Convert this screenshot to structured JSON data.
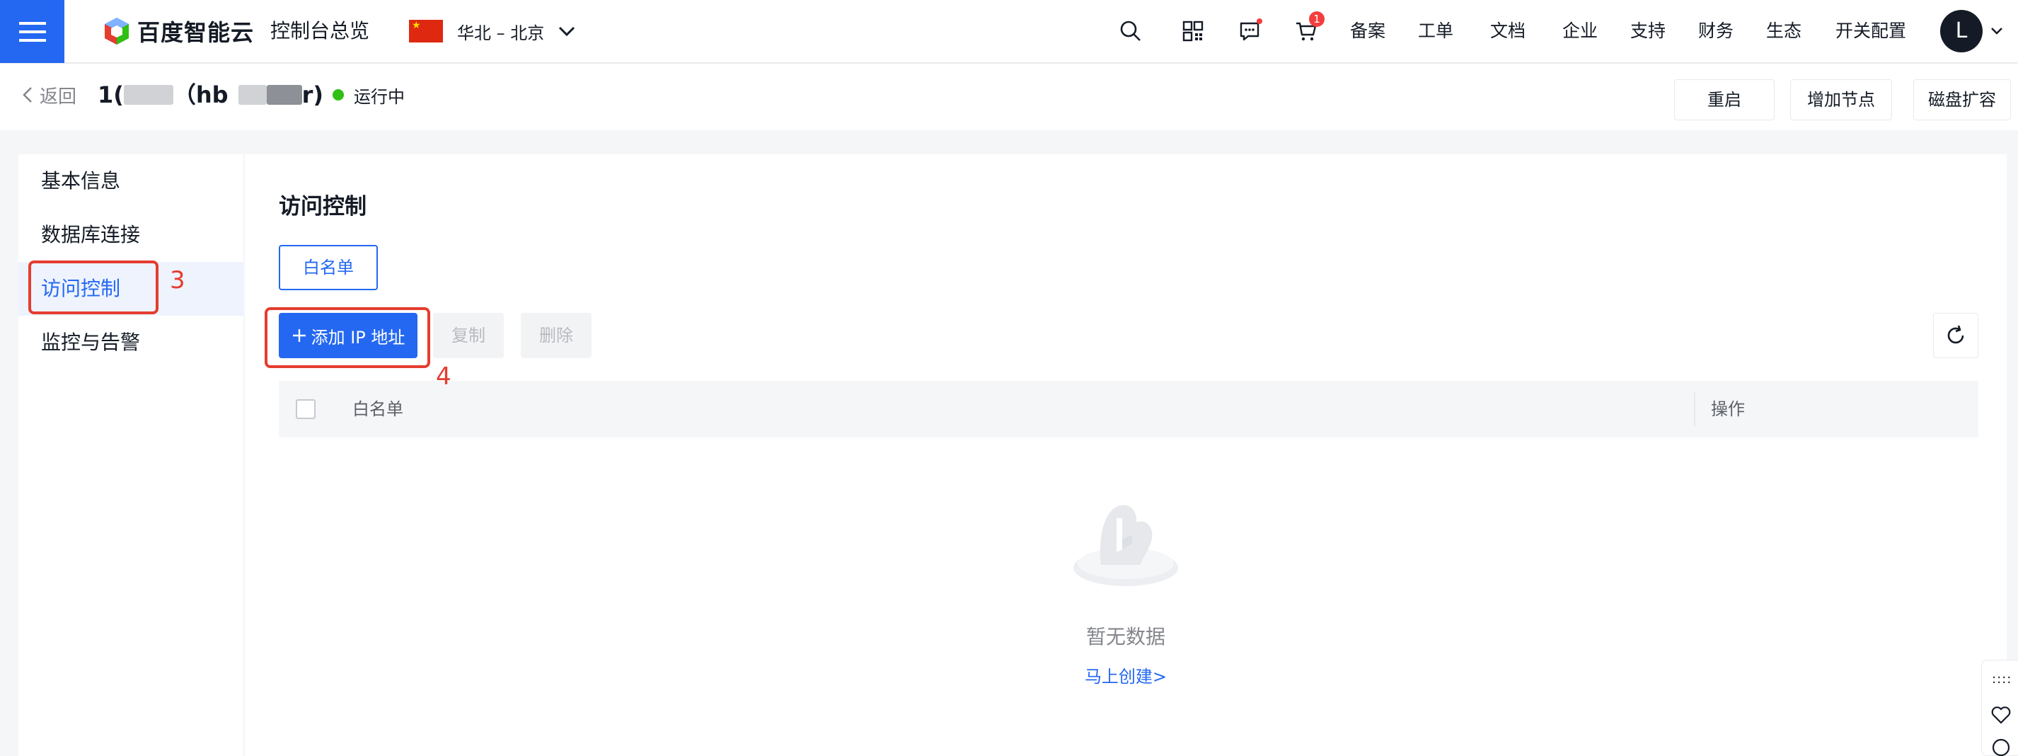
{
  "topbar": {
    "logo_text": "百度智能云",
    "console_title": "控制台总览",
    "region": "华北 – 北京",
    "cart_count": "1",
    "nav_links": [
      "备案",
      "工单",
      "文档",
      "企业",
      "支持",
      "财务",
      "生态",
      "开关配置"
    ],
    "avatar_initial": "L"
  },
  "subheader": {
    "back_label": "返回",
    "instance_name_prefix": "1(",
    "instance_name_mid": "（hb",
    "instance_name_suffix": "r)",
    "status": "运行中",
    "buttons": [
      "重启",
      "增加节点",
      "磁盘扩容"
    ]
  },
  "sidebar": {
    "items": [
      "基本信息",
      "数据库连接",
      "访问控制",
      "监控与告警"
    ],
    "active_index": 2
  },
  "main": {
    "section_title": "访问控制",
    "tab_label": "白名单",
    "add_button": "添加 IP 地址",
    "copy_button": "复制",
    "delete_button": "删除",
    "table": {
      "columns": [
        "白名单",
        "操作"
      ],
      "rows": []
    },
    "empty_text": "暂无数据",
    "create_link": "马上创建>"
  },
  "annotations": {
    "step3": "3",
    "step4": "4"
  },
  "float_tools": {
    "dots": "::::"
  },
  "colors": {
    "primary": "#2468f2",
    "annotation_red": "#e53d2f",
    "status_green": "#30bf13"
  }
}
